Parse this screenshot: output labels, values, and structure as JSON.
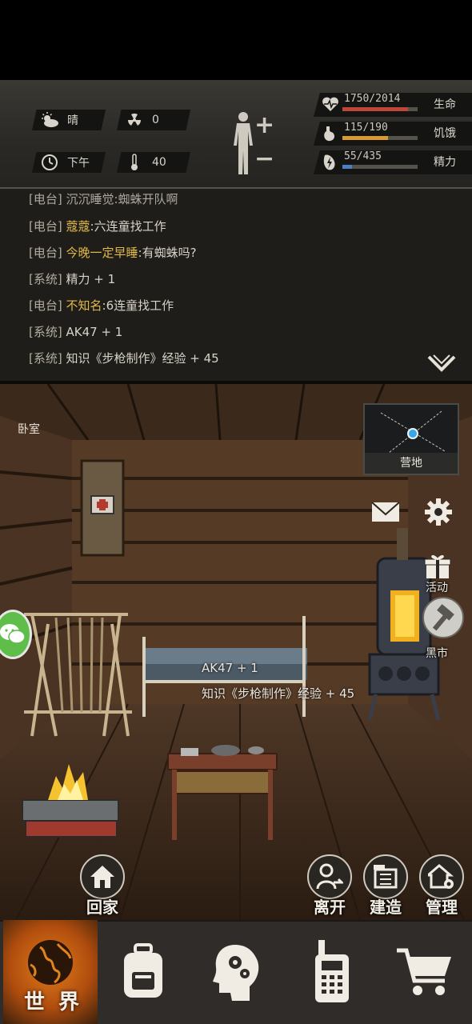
{
  "stats": {
    "weather": "晴",
    "radiation": "0",
    "time_of_day": "下午",
    "temperature": "40",
    "health": {
      "value": "1750/2014",
      "label": "生命",
      "ratio": 0.869,
      "color": "#c0453a"
    },
    "hunger": {
      "value": "115/190",
      "label": "饥饿",
      "ratio": 0.605,
      "color": "#d79a35"
    },
    "energy": {
      "value": "55/435",
      "label": "精力",
      "ratio": 0.126,
      "color": "#4a7fc4"
    }
  },
  "log": {
    "partial_line": "[电台] 沉沉睡觉:蜘蛛开队啊",
    "lines": [
      {
        "tag": "[电台]",
        "name": "蔻蔻",
        "msg": ":六连童找工作"
      },
      {
        "tag": "[电台]",
        "name": "今晚一定早睡",
        "msg": ":有蜘蛛吗?"
      },
      {
        "tag": "[系统]",
        "name": "",
        "msg": "精力 + 1"
      },
      {
        "tag": "[电台]",
        "name": "不知名",
        "msg": ":6连童找工作"
      },
      {
        "tag": "[系统]",
        "name": "",
        "msg": "AK47 + 1"
      },
      {
        "tag": "[系统]",
        "name": "",
        "msg": "知识《步枪制作》经验 + 45"
      }
    ]
  },
  "scene": {
    "room_name": "卧室",
    "minimap_label": "营地",
    "activity_label": "活动",
    "black_market_label": "黑市",
    "float_text_1": "AK47 + 1",
    "float_text_2": "知识《步枪制作》经验 + 45",
    "home_label": "回家",
    "leave_label": "离开",
    "build_label": "建造",
    "manage_label": "管理"
  },
  "nav": {
    "world_label": "世 界"
  },
  "colors": {
    "accent_orange": "#e07c1a",
    "gold_name": "#e0b848"
  }
}
